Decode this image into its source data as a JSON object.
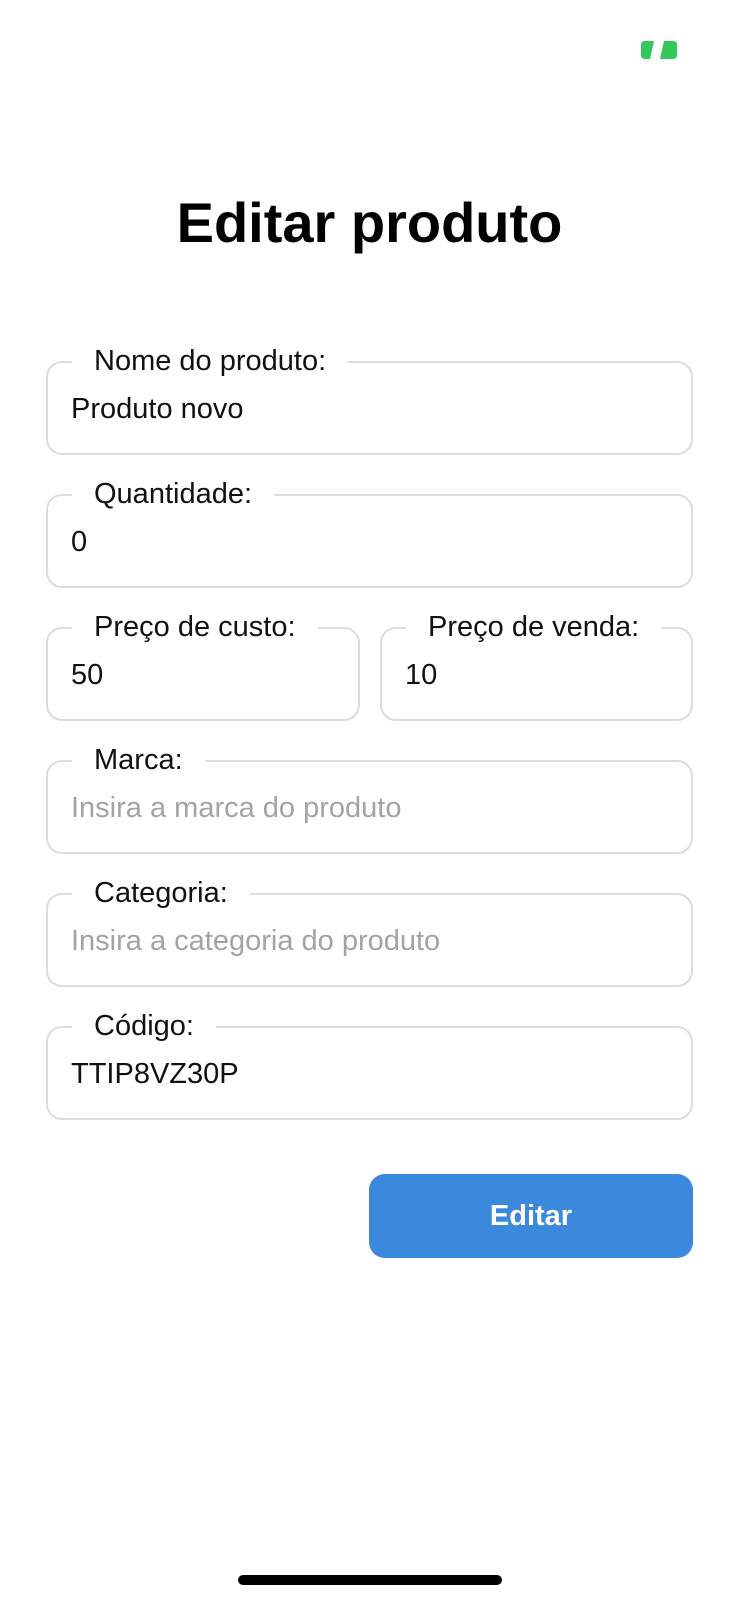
{
  "status_bar": {
    "camera_indicator_icon": "camera-in-use-icon",
    "indicator_color": "#34c759"
  },
  "header": {
    "title": "Editar produto"
  },
  "form": {
    "nome": {
      "label": "Nome do produto:",
      "value": "Produto novo",
      "placeholder": ""
    },
    "quantidade": {
      "label": "Quantidade:",
      "value": "0",
      "placeholder": ""
    },
    "preco_custo": {
      "label": "Preço de custo:",
      "value": "50",
      "placeholder": ""
    },
    "preco_venda": {
      "label": "Preço de venda:",
      "value": "10",
      "placeholder": ""
    },
    "marca": {
      "label": "Marca:",
      "value": "",
      "placeholder": "Insira a marca do produto"
    },
    "categoria": {
      "label": "Categoria:",
      "value": "",
      "placeholder": "Insira a categoria do produto"
    },
    "codigo": {
      "label": "Código:",
      "value": "TTIP8VZ30P",
      "placeholder": ""
    }
  },
  "actions": {
    "submit_label": "Editar",
    "submit_color": "#3b88dd"
  }
}
